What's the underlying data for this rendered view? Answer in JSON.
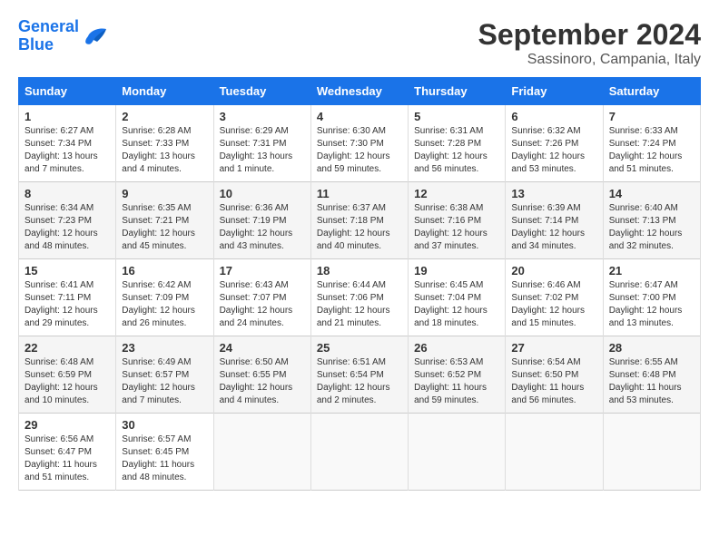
{
  "logo": {
    "line1": "General",
    "line2": "Blue"
  },
  "title": "September 2024",
  "location": "Sassinoro, Campania, Italy",
  "headers": [
    "Sunday",
    "Monday",
    "Tuesday",
    "Wednesday",
    "Thursday",
    "Friday",
    "Saturday"
  ],
  "weeks": [
    [
      {
        "day": "1",
        "sunrise": "6:27 AM",
        "sunset": "7:34 PM",
        "daylight": "13 hours and 7 minutes."
      },
      {
        "day": "2",
        "sunrise": "6:28 AM",
        "sunset": "7:33 PM",
        "daylight": "13 hours and 4 minutes."
      },
      {
        "day": "3",
        "sunrise": "6:29 AM",
        "sunset": "7:31 PM",
        "daylight": "13 hours and 1 minute."
      },
      {
        "day": "4",
        "sunrise": "6:30 AM",
        "sunset": "7:30 PM",
        "daylight": "12 hours and 59 minutes."
      },
      {
        "day": "5",
        "sunrise": "6:31 AM",
        "sunset": "7:28 PM",
        "daylight": "12 hours and 56 minutes."
      },
      {
        "day": "6",
        "sunrise": "6:32 AM",
        "sunset": "7:26 PM",
        "daylight": "12 hours and 53 minutes."
      },
      {
        "day": "7",
        "sunrise": "6:33 AM",
        "sunset": "7:24 PM",
        "daylight": "12 hours and 51 minutes."
      }
    ],
    [
      {
        "day": "8",
        "sunrise": "6:34 AM",
        "sunset": "7:23 PM",
        "daylight": "12 hours and 48 minutes."
      },
      {
        "day": "9",
        "sunrise": "6:35 AM",
        "sunset": "7:21 PM",
        "daylight": "12 hours and 45 minutes."
      },
      {
        "day": "10",
        "sunrise": "6:36 AM",
        "sunset": "7:19 PM",
        "daylight": "12 hours and 43 minutes."
      },
      {
        "day": "11",
        "sunrise": "6:37 AM",
        "sunset": "7:18 PM",
        "daylight": "12 hours and 40 minutes."
      },
      {
        "day": "12",
        "sunrise": "6:38 AM",
        "sunset": "7:16 PM",
        "daylight": "12 hours and 37 minutes."
      },
      {
        "day": "13",
        "sunrise": "6:39 AM",
        "sunset": "7:14 PM",
        "daylight": "12 hours and 34 minutes."
      },
      {
        "day": "14",
        "sunrise": "6:40 AM",
        "sunset": "7:13 PM",
        "daylight": "12 hours and 32 minutes."
      }
    ],
    [
      {
        "day": "15",
        "sunrise": "6:41 AM",
        "sunset": "7:11 PM",
        "daylight": "12 hours and 29 minutes."
      },
      {
        "day": "16",
        "sunrise": "6:42 AM",
        "sunset": "7:09 PM",
        "daylight": "12 hours and 26 minutes."
      },
      {
        "day": "17",
        "sunrise": "6:43 AM",
        "sunset": "7:07 PM",
        "daylight": "12 hours and 24 minutes."
      },
      {
        "day": "18",
        "sunrise": "6:44 AM",
        "sunset": "7:06 PM",
        "daylight": "12 hours and 21 minutes."
      },
      {
        "day": "19",
        "sunrise": "6:45 AM",
        "sunset": "7:04 PM",
        "daylight": "12 hours and 18 minutes."
      },
      {
        "day": "20",
        "sunrise": "6:46 AM",
        "sunset": "7:02 PM",
        "daylight": "12 hours and 15 minutes."
      },
      {
        "day": "21",
        "sunrise": "6:47 AM",
        "sunset": "7:00 PM",
        "daylight": "12 hours and 13 minutes."
      }
    ],
    [
      {
        "day": "22",
        "sunrise": "6:48 AM",
        "sunset": "6:59 PM",
        "daylight": "12 hours and 10 minutes."
      },
      {
        "day": "23",
        "sunrise": "6:49 AM",
        "sunset": "6:57 PM",
        "daylight": "12 hours and 7 minutes."
      },
      {
        "day": "24",
        "sunrise": "6:50 AM",
        "sunset": "6:55 PM",
        "daylight": "12 hours and 4 minutes."
      },
      {
        "day": "25",
        "sunrise": "6:51 AM",
        "sunset": "6:54 PM",
        "daylight": "12 hours and 2 minutes."
      },
      {
        "day": "26",
        "sunrise": "6:53 AM",
        "sunset": "6:52 PM",
        "daylight": "11 hours and 59 minutes."
      },
      {
        "day": "27",
        "sunrise": "6:54 AM",
        "sunset": "6:50 PM",
        "daylight": "11 hours and 56 minutes."
      },
      {
        "day": "28",
        "sunrise": "6:55 AM",
        "sunset": "6:48 PM",
        "daylight": "11 hours and 53 minutes."
      }
    ],
    [
      {
        "day": "29",
        "sunrise": "6:56 AM",
        "sunset": "6:47 PM",
        "daylight": "11 hours and 51 minutes."
      },
      {
        "day": "30",
        "sunrise": "6:57 AM",
        "sunset": "6:45 PM",
        "daylight": "11 hours and 48 minutes."
      },
      null,
      null,
      null,
      null,
      null
    ]
  ],
  "labels": {
    "sunrise": "Sunrise:",
    "sunset": "Sunset:",
    "daylight": "Daylight:"
  }
}
